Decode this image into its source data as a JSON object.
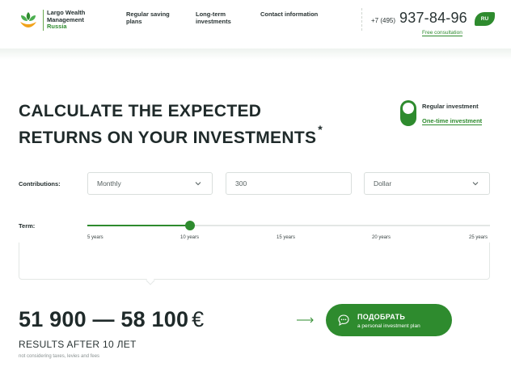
{
  "brand": {
    "line1": "Largo Wealth",
    "line2": "Management",
    "line3": "Russia"
  },
  "nav": {
    "item1_line1": "Regular saving",
    "item1_line2": "plans",
    "item2_line1": "Long-term",
    "item2_line2": "investments",
    "item3": "Contact information"
  },
  "contact": {
    "phone_prefix": "+7 (495)",
    "phone_number": "937-84-96",
    "consultation_link": "Free consultation",
    "language": "RU"
  },
  "calculator": {
    "title_line1": "CALCULATE THE EXPECTED",
    "title_line2": "RETURNS ON YOUR INVESTMENTS",
    "title_mark": "*",
    "mode_options": [
      "Regular investment",
      "One-time investment"
    ],
    "contributions_label": "Contributions:",
    "frequency_value": "Monthly",
    "amount_value": "300",
    "currency_value": "Dollar",
    "term_label": "Term:",
    "term_ticks": [
      "5 years",
      "10 years",
      "15 years",
      "20 years",
      "25 years"
    ],
    "term_selected": "10 years",
    "term_min_years": 5,
    "term_max_years": 25,
    "term_value_years": 10
  },
  "result": {
    "range": "51 900 — 58 100",
    "currency_symbol": "€",
    "caption": "RESULTS AFTER 10 ЛЕТ",
    "note": "not considering taxes, levies and fees",
    "cta_title": "ПОДОБРАТЬ",
    "cta_subtitle": "a personal investment plan"
  },
  "colors": {
    "accent": "#2e8b2e",
    "text": "#1f2a2a",
    "border": "#d9dedc"
  },
  "icons": [
    "leaf-logo-icon",
    "chevron-down-icon",
    "arrow-right-icon",
    "chat-bubble-icon"
  ]
}
